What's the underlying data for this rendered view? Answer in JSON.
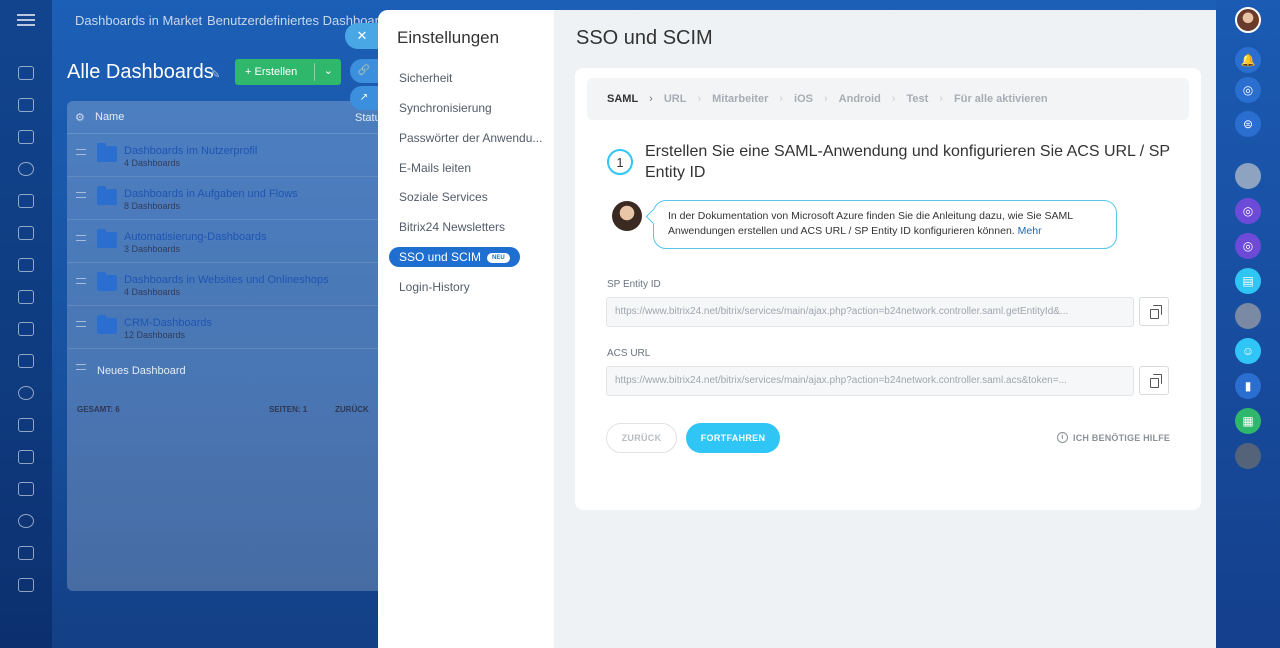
{
  "background": {
    "topbar": [
      "Dashboards in Market",
      "Benutzerdefiniertes Dashboard a"
    ],
    "page_title": "Alle Dashboards",
    "create_label": "+ Erstellen",
    "grid": {
      "col_name": "Name",
      "col_status": "Statu",
      "rows": [
        {
          "name": "Dashboards im Nutzerprofil",
          "count": "4 Dashboards"
        },
        {
          "name": "Dashboards in Aufgaben und Flows",
          "count": "8 Dashboards"
        },
        {
          "name": "Automatisierung-Dashboards",
          "count": "3 Dashboards"
        },
        {
          "name": "Dashboards in Websites und Onlineshops",
          "count": "4 Dashboards"
        },
        {
          "name": "CRM-Dashboards",
          "count": "12 Dashboards"
        }
      ],
      "new_dashboard": "Neues Dashboard",
      "total": "GESAMT: 6",
      "pages": "SEITEN: 1",
      "back": "ZURÜCK"
    }
  },
  "settings": {
    "nav_title": "Einstellungen",
    "nav_items": [
      {
        "label": "Sicherheit"
      },
      {
        "label": "Synchronisierung"
      },
      {
        "label": "Passwörter der Anwendu..."
      },
      {
        "label": "E-Mails leiten"
      },
      {
        "label": "Soziale Services"
      },
      {
        "label": "Bitrix24 Newsletters"
      },
      {
        "label": "SSO und SCIM",
        "badge": "NEU"
      },
      {
        "label": "Login-History"
      }
    ],
    "page_title": "SSO und SCIM",
    "steps": [
      "SAML",
      "URL",
      "Mitarbeiter",
      "iOS",
      "Android",
      "Test",
      "Für alle aktivieren"
    ],
    "step_number": "1",
    "step_heading": "Erstellen Sie eine SAML-Anwendung und konfigurieren Sie ACS URL / SP Entity ID",
    "hint_text": "In der Dokumentation von Microsoft Azure finden Sie die Anleitung dazu, wie Sie SAML Anwendungen erstellen und ACS URL / SP Entity ID konfigurieren können.",
    "hint_link": "Mehr",
    "sp_entity_label": "SP Entity ID",
    "sp_entity_value": "https://www.bitrix24.net/bitrix/services/main/ajax.php?action=b24network.controller.saml.getEntityId&...",
    "acs_label": "ACS URL",
    "acs_value": "https://www.bitrix24.net/bitrix/services/main/ajax.php?action=b24network.controller.saml.acs&token=...",
    "back_button": "ZURÜCK",
    "next_button": "FORTFAHREN",
    "help_label": "ICH BENÖTIGE HILFE"
  },
  "colors": {
    "accent": "#2fc6f6",
    "nav_active": "#1f6fd1",
    "link": "#2067b0"
  }
}
